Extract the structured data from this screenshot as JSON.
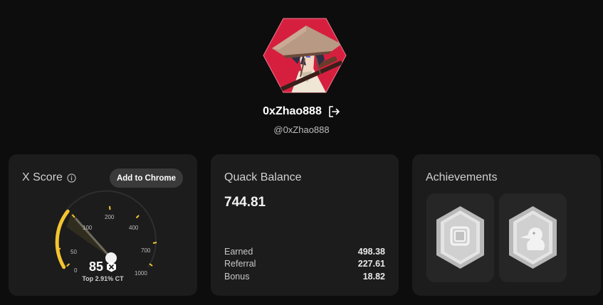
{
  "profile": {
    "username": "0xZhao888",
    "handle": "@0xZhao888",
    "avatar_icon": "samurai-avatar",
    "logout_icon": "logout-icon",
    "accent": "#d61f3f"
  },
  "x_score": {
    "title": "X Score",
    "info_icon": "info-icon",
    "button_label": "Add to Chrome",
    "gauge_ticks": [
      "0",
      "50",
      "100",
      "200",
      "400",
      "700",
      "1000"
    ],
    "value": "85",
    "subtext": "Top 2.91% CT",
    "badge_icon": "x-badge-icon",
    "accent": "#f4c430"
  },
  "quack_balance": {
    "title": "Quack Balance",
    "balance": "744.81",
    "rows": [
      {
        "label": "Earned",
        "value": "498.38"
      },
      {
        "label": "Referral",
        "value": "227.61"
      },
      {
        "label": "Bonus",
        "value": "18.82"
      }
    ]
  },
  "achievements": {
    "title": "Achievements",
    "items": [
      {
        "icon": "square-badge-icon"
      },
      {
        "icon": "duck-badge-icon"
      }
    ]
  }
}
